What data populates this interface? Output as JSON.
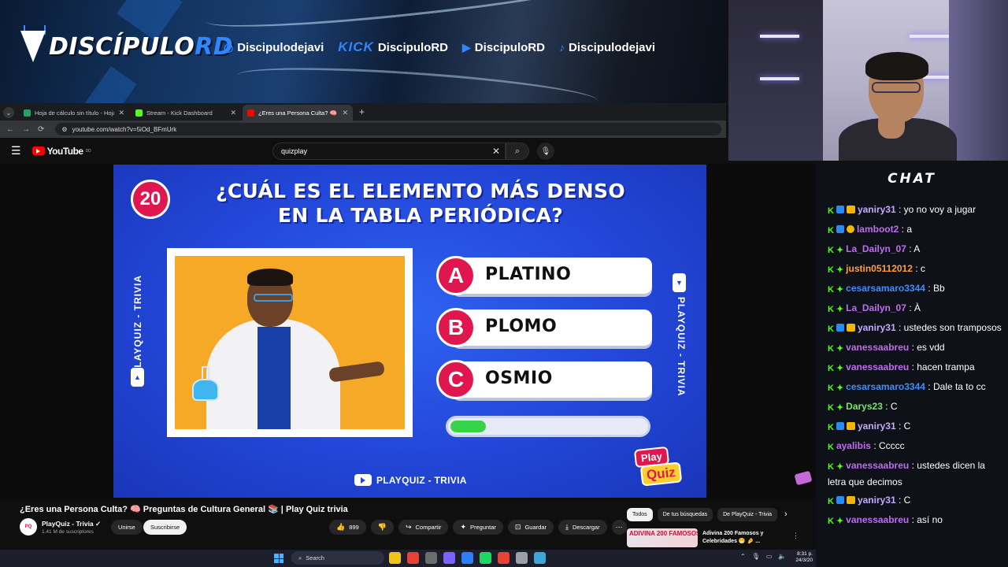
{
  "banner": {
    "logo_main": "DISCÍPULO",
    "logo_accent": "RD",
    "socials": [
      {
        "icon": "instagram-icon",
        "platform": "",
        "handle": "Discipulodejavi"
      },
      {
        "icon": "kick-icon",
        "platform": "KICK",
        "handle": "DiscipuloRD"
      },
      {
        "icon": "youtube-icon",
        "platform": "",
        "handle": "DiscipuloRD"
      },
      {
        "icon": "tiktok-icon",
        "platform": "",
        "handle": "Discipulodejavi"
      }
    ]
  },
  "browser": {
    "tabs": [
      {
        "label": "Hoja de cálculo sin título - Hoja",
        "favicon_color": "#1fa463",
        "active": false
      },
      {
        "label": "Stream - Kick Dashboard",
        "favicon_color": "#53fc18",
        "active": false
      },
      {
        "label": "¿Eres una Persona Culta? 🧠 🔊",
        "favicon_color": "#ff0000",
        "active": true
      }
    ],
    "url": "youtube.com/watch?v=5iOd_BFmUrk"
  },
  "youtube": {
    "logo": "YouTube",
    "logo_sup": "DO",
    "search_value": "quizplay"
  },
  "quiz": {
    "number": "20",
    "question_line1": "¿CUÁL ES EL ELEMENTO MÁS DENSO",
    "question_line2": "EN LA TABLA PERIÓDICA?",
    "side_label": "PLAYQUIZ - TRIVIA",
    "answers": [
      {
        "letter": "A",
        "text": "PLATINO"
      },
      {
        "letter": "B",
        "text": "PLOMO"
      },
      {
        "letter": "C",
        "text": "OSMIO"
      }
    ],
    "timer_progress": 0.18,
    "logo_play": "Play",
    "logo_quiz": "Quiz",
    "channel_tag": "PLAYQUIZ - TRIVIA"
  },
  "video": {
    "title": "¿Eres una Persona Culta? 🧠 Preguntas de Cultura General 📚 | Play Quiz trivia",
    "channel": "PlayQuiz - Trivia",
    "subscribers": "1.41 M de suscriptores",
    "join_label": "Unirse",
    "subscribe_label": "Suscribirse",
    "likes": "899",
    "share_label": "Compartir",
    "ask_label": "Preguntar",
    "save_label": "Guardar",
    "download_label": "Descargar",
    "chips": [
      "Todos",
      "De tus búsquedas",
      "De PlayQuiz - Trivia"
    ],
    "rec_thumb": "ADIVINA 200 FAMOSOS",
    "rec_title": "Adivina 200 Famosos y Celebridades 😁 🤌 ..."
  },
  "chat": {
    "title": "CHAT",
    "messages": [
      {
        "badges": [
          "kick",
          "blue",
          "sub"
        ],
        "user": "yaniry31",
        "color": "#c6a8ff",
        "text": "yo no voy a jugar"
      },
      {
        "badges": [
          "kick",
          "blue",
          "gift"
        ],
        "user": "lamboot2",
        "color": "#c06bf0",
        "text": "a"
      },
      {
        "badges": [
          "kick",
          "star"
        ],
        "user": "La_Dailyn_07",
        "color": "#c06bf0",
        "text": "A"
      },
      {
        "badges": [
          "kick",
          "star"
        ],
        "user": "justin05112012",
        "color": "#ff9f40",
        "text": "c"
      },
      {
        "badges": [
          "kick",
          "star"
        ],
        "user": "cesarsamaro3344",
        "color": "#3f8cff",
        "text": "Bb"
      },
      {
        "badges": [
          "kick",
          "star"
        ],
        "user": "La_Dailyn_07",
        "color": "#c06bf0",
        "text": "À"
      },
      {
        "badges": [
          "kick",
          "blue",
          "sub"
        ],
        "user": "yaniry31",
        "color": "#c6a8ff",
        "text": "ustedes son tramposos"
      },
      {
        "badges": [
          "kick",
          "star"
        ],
        "user": "vanessaabreu",
        "color": "#c06bf0",
        "text": "es vdd"
      },
      {
        "badges": [
          "kick",
          "star"
        ],
        "user": "vanessaabreu",
        "color": "#c06bf0",
        "text": "hacen trampa"
      },
      {
        "badges": [
          "kick",
          "star"
        ],
        "user": "cesarsamaro3344",
        "color": "#3f8cff",
        "text": "Dale ta to cc"
      },
      {
        "badges": [
          "kick",
          "star"
        ],
        "user": "Darys23",
        "color": "#7de26b",
        "text": "C"
      },
      {
        "badges": [
          "kick",
          "blue",
          "sub"
        ],
        "user": "yaniry31",
        "color": "#c6a8ff",
        "text": "C"
      },
      {
        "badges": [
          "kick"
        ],
        "user": "ayalibis",
        "color": "#c06bf0",
        "text": "Ccccc"
      },
      {
        "badges": [
          "kick",
          "star"
        ],
        "user": "vanessaabreu",
        "color": "#c06bf0",
        "text": "ustedes dicen la letra que decimos"
      },
      {
        "badges": [
          "kick",
          "blue",
          "sub"
        ],
        "user": "yaniry31",
        "color": "#c6a8ff",
        "text": "C"
      },
      {
        "badges": [
          "kick",
          "star"
        ],
        "user": "vanessaabreu",
        "color": "#c06bf0",
        "text": "así no"
      }
    ]
  },
  "taskbar": {
    "search_label": "Search",
    "time": "8:31 p.",
    "date": "24/3/20",
    "app_colors": [
      "#f2c318",
      "#e94235",
      "#6c6c6c",
      "#7b61ff",
      "#2d7ff9",
      "#1ed760",
      "#e94235",
      "#9aa0a6",
      "#3da5d9"
    ]
  }
}
